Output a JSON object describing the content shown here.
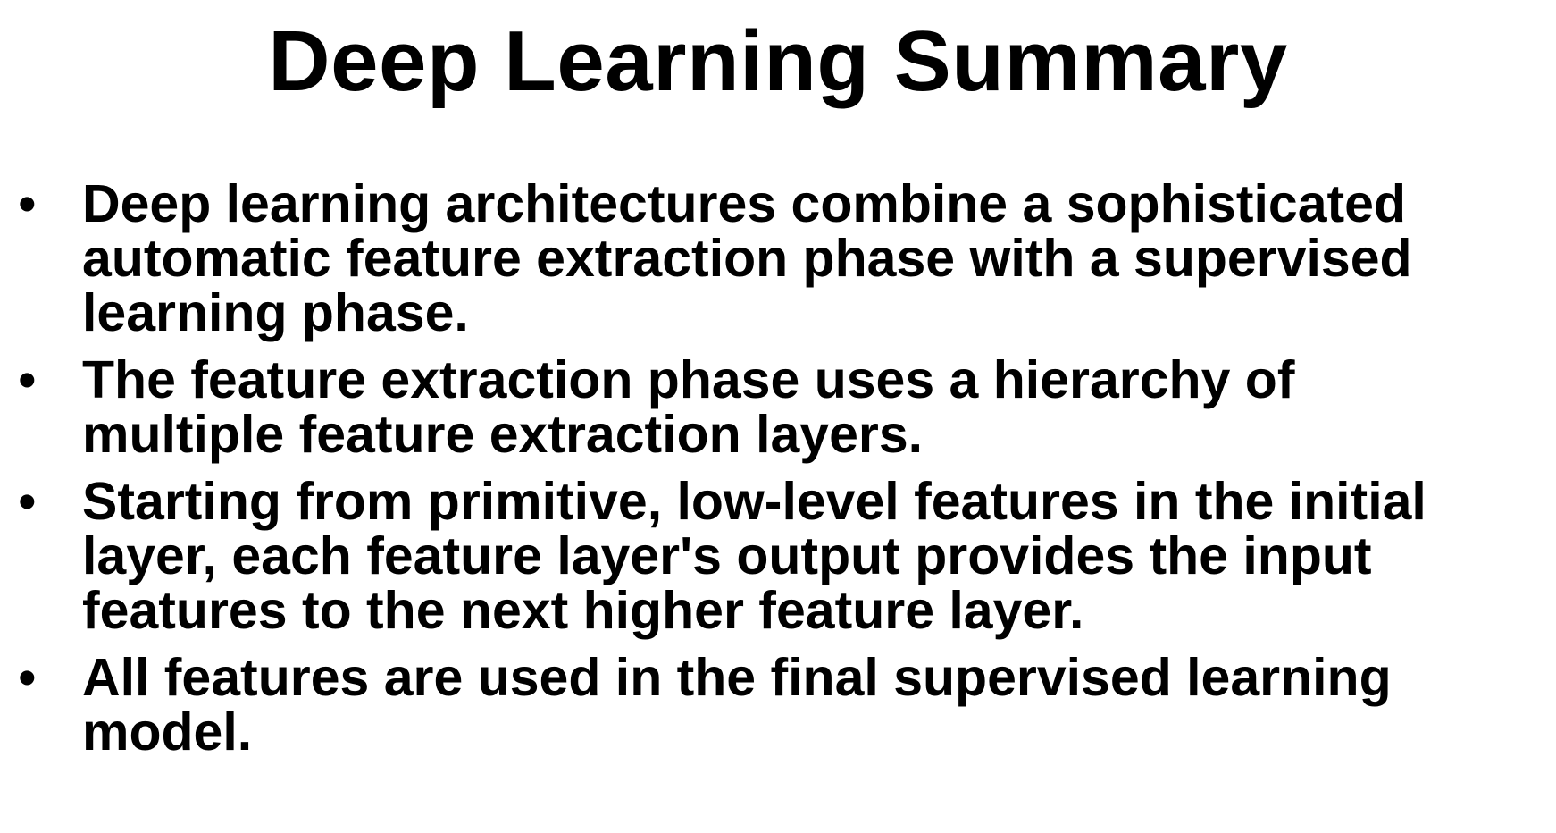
{
  "slide": {
    "title": "Deep Learning Summary",
    "bullet_glyph": "•",
    "bullets": [
      {
        "text": "Deep learning architectures combine a sophisticated\nautomatic feature extraction phase with a supervised\nlearning phase."
      },
      {
        "text": "The feature extraction phase uses a hierarchy of\nmultiple feature extraction layers."
      },
      {
        "text": "Starting from primitive, low-level features in the initial\nlayer, each feature layer's output provides the input\nfeatures to the next higher feature layer."
      },
      {
        "text": "All features are used in the final supervised learning\nmodel."
      }
    ]
  },
  "colors": {
    "background": "#ffffff",
    "text": "#000000"
  }
}
